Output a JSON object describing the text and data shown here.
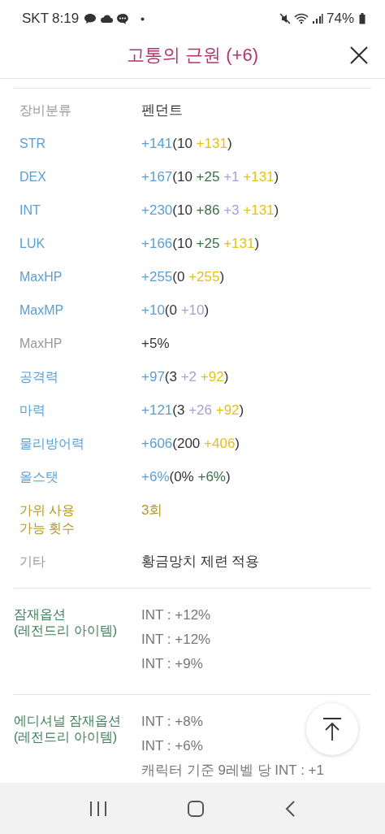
{
  "status_bar": {
    "carrier": "SKT",
    "time": "8:19",
    "battery": "74%"
  },
  "header": {
    "title": "고통의 근원 (+6)"
  },
  "rows": [
    {
      "label": "장비분류",
      "kind": "plain",
      "segments": [
        {
          "text": "펜던트",
          "kind": "base"
        }
      ]
    },
    {
      "label": "STR",
      "kind": "stat",
      "segments": [
        {
          "text": "+141",
          "kind": "total"
        },
        {
          "text": "(10 ",
          "kind": "base"
        },
        {
          "text": "+131",
          "kind": "scroll"
        },
        {
          "text": ")",
          "kind": "base"
        }
      ]
    },
    {
      "label": "DEX",
      "kind": "stat",
      "segments": [
        {
          "text": "+167",
          "kind": "total"
        },
        {
          "text": "(10 ",
          "kind": "base"
        },
        {
          "text": "+25 ",
          "kind": "add"
        },
        {
          "text": "+1 ",
          "kind": "star"
        },
        {
          "text": "+131",
          "kind": "scroll"
        },
        {
          "text": ")",
          "kind": "base"
        }
      ]
    },
    {
      "label": "INT",
      "kind": "stat",
      "segments": [
        {
          "text": "+230",
          "kind": "total"
        },
        {
          "text": "(10 ",
          "kind": "base"
        },
        {
          "text": "+86 ",
          "kind": "add"
        },
        {
          "text": "+3 ",
          "kind": "star"
        },
        {
          "text": "+131",
          "kind": "scroll"
        },
        {
          "text": ")",
          "kind": "base"
        }
      ]
    },
    {
      "label": "LUK",
      "kind": "stat",
      "segments": [
        {
          "text": "+166",
          "kind": "total"
        },
        {
          "text": "(10 ",
          "kind": "base"
        },
        {
          "text": "+25 ",
          "kind": "add"
        },
        {
          "text": "+131",
          "kind": "scroll"
        },
        {
          "text": ")",
          "kind": "base"
        }
      ]
    },
    {
      "label": "MaxHP",
      "kind": "stat",
      "segments": [
        {
          "text": "+255",
          "kind": "total"
        },
        {
          "text": "(0 ",
          "kind": "base"
        },
        {
          "text": "+255",
          "kind": "scroll"
        },
        {
          "text": ")",
          "kind": "base"
        }
      ]
    },
    {
      "label": "MaxMP",
      "kind": "stat",
      "segments": [
        {
          "text": "+10",
          "kind": "total"
        },
        {
          "text": "(0 ",
          "kind": "base"
        },
        {
          "text": "+10",
          "kind": "star"
        },
        {
          "text": ")",
          "kind": "base"
        }
      ]
    },
    {
      "label": "MaxHP",
      "kind": "plain",
      "segments": [
        {
          "text": "+5%",
          "kind": "base"
        }
      ]
    },
    {
      "label": "공격력",
      "kind": "stat",
      "segments": [
        {
          "text": "+97",
          "kind": "total"
        },
        {
          "text": "(3 ",
          "kind": "base"
        },
        {
          "text": "+2 ",
          "kind": "star"
        },
        {
          "text": "+92",
          "kind": "scroll"
        },
        {
          "text": ")",
          "kind": "base"
        }
      ]
    },
    {
      "label": "마력",
      "kind": "stat",
      "segments": [
        {
          "text": "+121",
          "kind": "total"
        },
        {
          "text": "(3 ",
          "kind": "base"
        },
        {
          "text": "+26 ",
          "kind": "star"
        },
        {
          "text": "+92",
          "kind": "scroll"
        },
        {
          "text": ")",
          "kind": "base"
        }
      ]
    },
    {
      "label": "물리방어력",
      "kind": "stat",
      "segments": [
        {
          "text": "+606",
          "kind": "total"
        },
        {
          "text": "(200 ",
          "kind": "base"
        },
        {
          "text": "+406",
          "kind": "scroll"
        },
        {
          "text": ")",
          "kind": "base"
        }
      ]
    },
    {
      "label": "올스탯",
      "kind": "stat",
      "segments": [
        {
          "text": "+6%",
          "kind": "total"
        },
        {
          "text": "(0% ",
          "kind": "base"
        },
        {
          "text": "+6%",
          "kind": "add"
        },
        {
          "text": ")",
          "kind": "base"
        }
      ]
    },
    {
      "label": "가위 사용\n가능 횟수",
      "kind": "special",
      "segments": [
        {
          "text": "3회",
          "kind": "special"
        }
      ]
    },
    {
      "label": "기타",
      "kind": "plain",
      "segments": [
        {
          "text": "황금망치 제련 적용",
          "kind": "base"
        }
      ]
    }
  ],
  "potentials": [
    {
      "title": "잠재옵션\n(레전드리 아이템)",
      "lines": [
        "INT : +12%",
        "INT : +12%",
        "INT : +9%"
      ]
    },
    {
      "title": "에디셔널 잠재옵션\n(레전드리 아이템)",
      "lines": [
        "INT : +8%",
        "INT : +6%",
        "캐릭터 기준 9레벨 당 INT : +1"
      ]
    }
  ]
}
